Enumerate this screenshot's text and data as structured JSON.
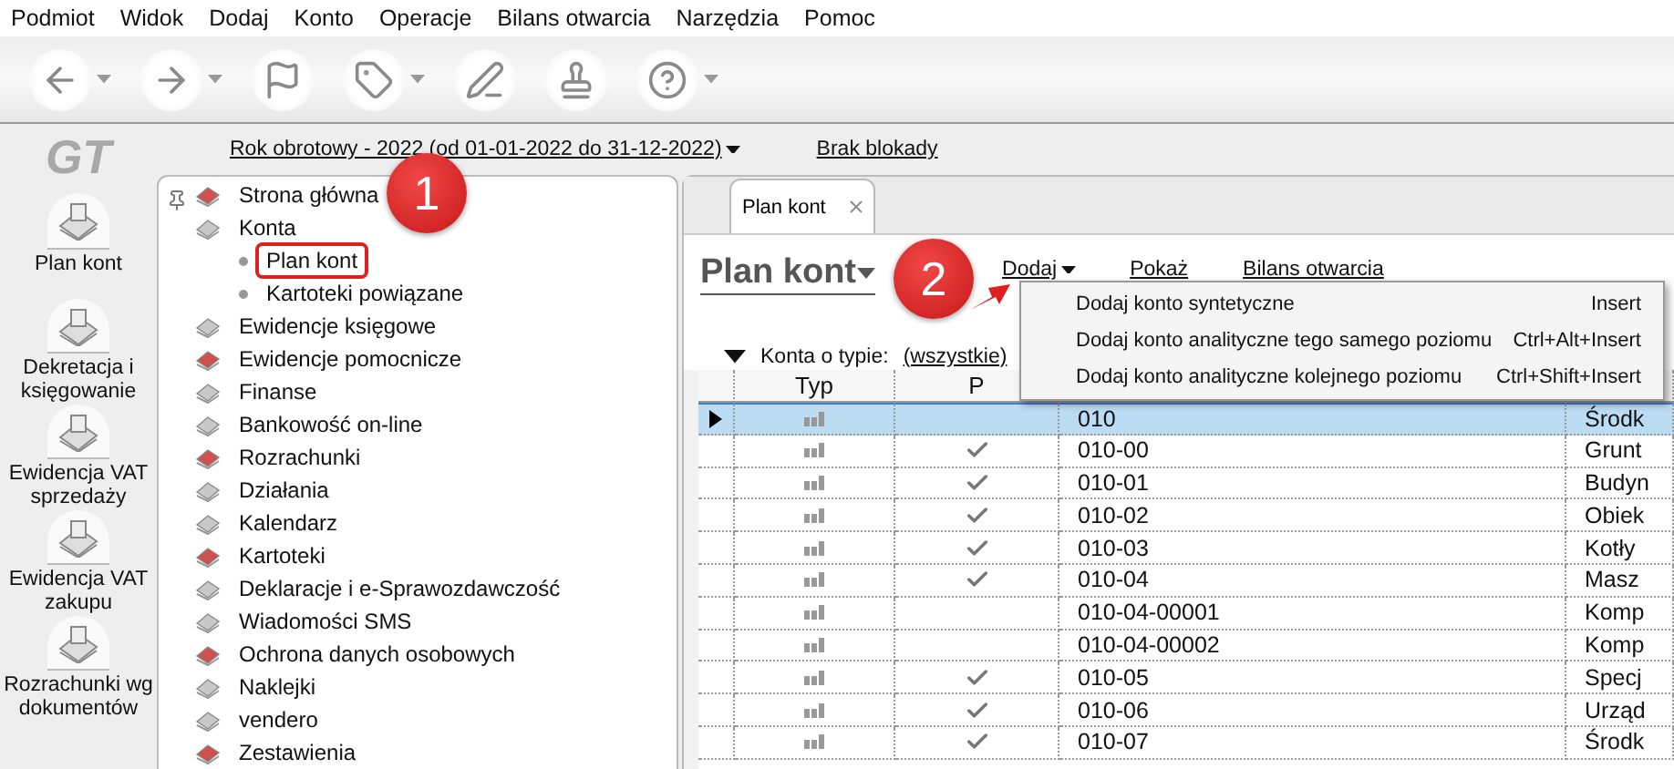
{
  "menu": [
    "Podmiot",
    "Widok",
    "Dodaj",
    "Konto",
    "Operacje",
    "Bilans otwarcia",
    "Narzędzia",
    "Pomoc"
  ],
  "toolbar": [
    {
      "kind": "back",
      "dropdown": true
    },
    {
      "kind": "forward",
      "dropdown": true
    },
    {
      "kind": "flag",
      "dropdown": false
    },
    {
      "kind": "tag",
      "dropdown": true
    },
    {
      "kind": "pen",
      "dropdown": false
    },
    {
      "kind": "stamp",
      "dropdown": false
    },
    {
      "kind": "help",
      "dropdown": true
    }
  ],
  "logo": "GT",
  "rail": [
    {
      "label": "Plan kont"
    },
    {
      "label": "Dekretacja i księgowanie"
    },
    {
      "label": "Ewidencja VAT sprzedaży"
    },
    {
      "label": "Ewidencja VAT zakupu"
    },
    {
      "label": "Rozrachunki wg dokumentów"
    }
  ],
  "year_link": "Rok obrotowy - 2022  (od 01-01-2022 do 31-12-2022)",
  "lock_link": "Brak blokady",
  "tree": [
    {
      "label": "Strona główna"
    },
    {
      "label": "Konta",
      "children": [
        {
          "label": "Plan kont",
          "highlighted": true
        },
        {
          "label": "Kartoteki powiązane",
          "highlighted": false
        }
      ]
    },
    {
      "label": "Ewidencje księgowe"
    },
    {
      "label": "Ewidencje pomocnicze"
    },
    {
      "label": "Finanse"
    },
    {
      "label": "Bankowość on-line"
    },
    {
      "label": "Rozrachunki"
    },
    {
      "label": "Działania"
    },
    {
      "label": "Kalendarz"
    },
    {
      "label": "Kartoteki"
    },
    {
      "label": "Deklaracje i e-Sprawozdawczość"
    },
    {
      "label": "Wiadomości SMS"
    },
    {
      "label": "Ochrona danych osobowych"
    },
    {
      "label": "Naklejki"
    },
    {
      "label": "vendero"
    },
    {
      "label": "Zestawienia"
    }
  ],
  "tab": {
    "label": "Plan kont"
  },
  "title": "Plan kont",
  "actions": [
    "Dodaj",
    "Pokaż",
    "Bilans otwarcia"
  ],
  "dropdown_menu": [
    {
      "label": "Dodaj konto syntetyczne",
      "shortcut": "Insert"
    },
    {
      "label": "Dodaj konto analityczne tego samego poziomu",
      "shortcut": "Ctrl+Alt+Insert"
    },
    {
      "label": "Dodaj konto analityczne kolejnego poziomu",
      "shortcut": "Ctrl+Shift+Insert"
    }
  ],
  "filter": {
    "label": "Konta o typie:",
    "value": "(wszystkie)"
  },
  "table": {
    "columns": [
      "Typ",
      "P"
    ],
    "rows": [
      {
        "selected": true,
        "posted": false,
        "symbol": "010",
        "name": "Środk"
      },
      {
        "selected": false,
        "posted": true,
        "symbol": "010-00",
        "name": "Grunt"
      },
      {
        "selected": false,
        "posted": true,
        "symbol": "010-01",
        "name": "Budyn"
      },
      {
        "selected": false,
        "posted": true,
        "symbol": "010-02",
        "name": "Obiek"
      },
      {
        "selected": false,
        "posted": true,
        "symbol": "010-03",
        "name": "Kotły"
      },
      {
        "selected": false,
        "posted": true,
        "symbol": "010-04",
        "name": "Masz"
      },
      {
        "selected": false,
        "posted": false,
        "symbol": "010-04-00001",
        "name": "Komp"
      },
      {
        "selected": false,
        "posted": false,
        "symbol": "010-04-00002",
        "name": "Komp"
      },
      {
        "selected": false,
        "posted": true,
        "symbol": "010-05",
        "name": "Specj"
      },
      {
        "selected": false,
        "posted": true,
        "symbol": "010-06",
        "name": "Urząd"
      },
      {
        "selected": false,
        "posted": true,
        "symbol": "010-07",
        "name": "Środk"
      }
    ]
  },
  "annotations": [
    {
      "label": "1"
    },
    {
      "label": "2"
    }
  ]
}
